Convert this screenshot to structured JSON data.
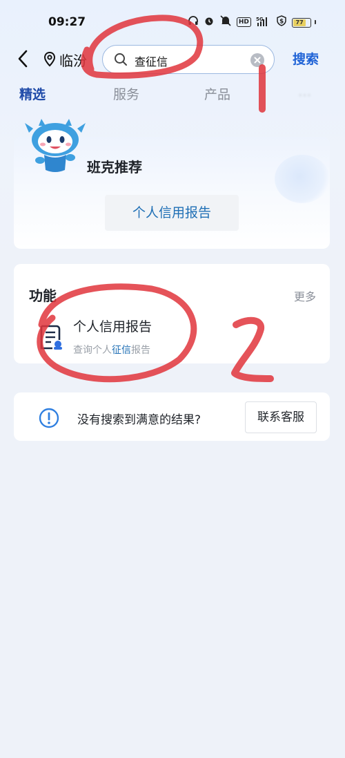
{
  "status_bar": {
    "time": "09:27",
    "battery": "77",
    "icons": [
      "headphones-icon",
      "alarm-icon",
      "mute-icon",
      "hd-icon",
      "5g-signal-icon",
      "shield-dollar-icon",
      "battery-icon"
    ]
  },
  "header": {
    "location": "临汾",
    "search_query": "查征信",
    "search_button": "搜索"
  },
  "tabs": [
    {
      "label": "精选",
      "active": true
    },
    {
      "label": "服务",
      "active": false
    },
    {
      "label": "产品",
      "active": false
    },
    {
      "label": "…",
      "active": false
    }
  ],
  "recommend": {
    "title": "班克推荐",
    "item": "个人信用报告"
  },
  "functions": {
    "title": "功能",
    "more": "更多",
    "item_name": "个人信用报告",
    "item_desc_prefix": "查询个人",
    "item_desc_highlight": "征信",
    "item_desc_suffix": "报告"
  },
  "feedback": {
    "text": "没有搜索到满意的结果?",
    "button": "联系客服"
  },
  "annotations": {
    "labels": [
      "1",
      "2"
    ],
    "color": "#e0353c"
  },
  "colors": {
    "accent": "#1f63d6",
    "link": "#1f6fb5",
    "background": "#eef2f9"
  }
}
